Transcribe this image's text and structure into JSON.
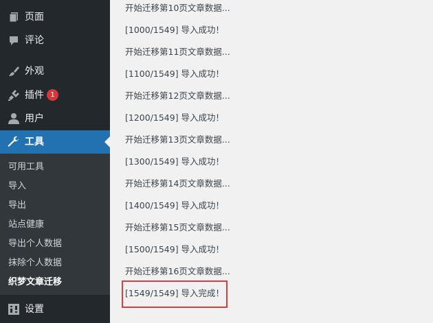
{
  "sidebar": {
    "menu": [
      {
        "id": "pages",
        "label": "页面",
        "icon": "page-icon"
      },
      {
        "id": "comments",
        "label": "评论",
        "icon": "comment-icon"
      },
      {
        "id": "appearance",
        "label": "外观",
        "icon": "paintbrush-icon"
      },
      {
        "id": "plugins",
        "label": "插件",
        "icon": "plugin-icon",
        "badge": "1"
      },
      {
        "id": "users",
        "label": "用户",
        "icon": "user-icon"
      },
      {
        "id": "tools",
        "label": "工具",
        "icon": "wrench-icon",
        "active": true
      },
      {
        "id": "settings",
        "label": "设置",
        "icon": "settings-icon"
      }
    ],
    "submenu": [
      {
        "label": "可用工具"
      },
      {
        "label": "导入"
      },
      {
        "label": "导出"
      },
      {
        "label": "站点健康"
      },
      {
        "label": "导出个人数据"
      },
      {
        "label": "抹除个人数据"
      },
      {
        "label": "织梦文章迁移",
        "current": true
      }
    ]
  },
  "log": [
    "开始迁移第10页文章数据...",
    "[1000/1549] 导入成功！",
    "开始迁移第11页文章数据...",
    "[1100/1549] 导入成功！",
    "开始迁移第12页文章数据...",
    "[1200/1549] 导入成功！",
    "开始迁移第13页文章数据...",
    "[1300/1549] 导入成功！",
    "开始迁移第14页文章数据...",
    "[1400/1549] 导入成功！",
    "开始迁移第15页文章数据...",
    "[1500/1549] 导入成功！",
    "开始迁移第16页文章数据..."
  ],
  "final_line": "[1549/1549] 导入完成！",
  "colors": {
    "sidebar_bg": "#23282d",
    "submenu_bg": "#32373c",
    "active_bg": "#2271b1",
    "badge": "#d63638",
    "highlight_border": "#e03c3c"
  }
}
